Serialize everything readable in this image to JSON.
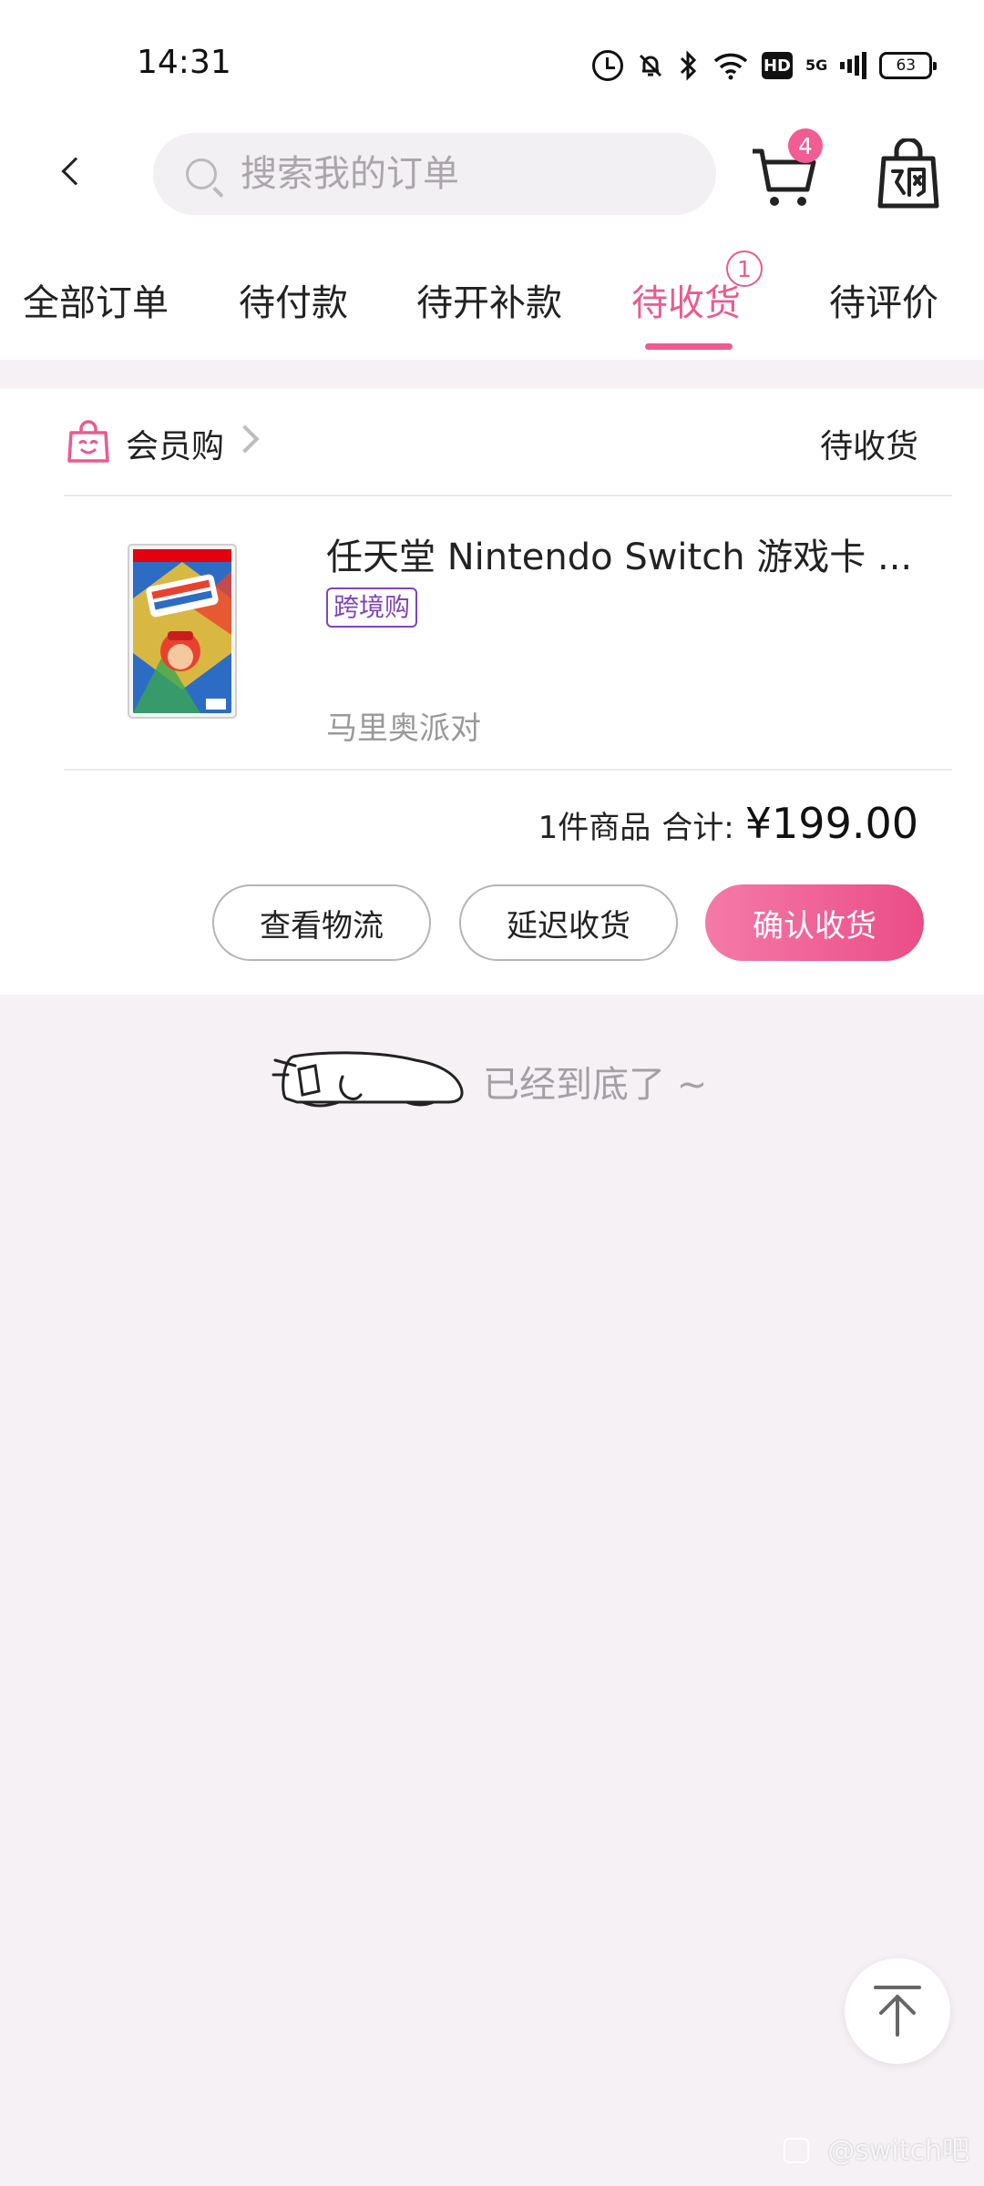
{
  "status_bar": {
    "time": "14:31",
    "icons": [
      "alarm-icon",
      "bell-off-icon",
      "bluetooth-icon",
      "wifi-icon",
      "hd-icon",
      "5g-signal-icon",
      "battery-icon"
    ],
    "hd_label": "HD",
    "network_label": "5G",
    "battery": "63"
  },
  "header": {
    "search_placeholder": "搜索我的订单",
    "cart_badge": "4",
    "colors": {
      "accent": "#eb5a90"
    }
  },
  "tabs": [
    {
      "label": "全部订单",
      "active": false
    },
    {
      "label": "待付款",
      "active": false
    },
    {
      "label": "待开补款",
      "active": false
    },
    {
      "label": "待收货",
      "active": true,
      "badge": "1"
    },
    {
      "label": "待评价",
      "active": false
    }
  ],
  "order": {
    "store_name": "会员购",
    "status": "待收货",
    "product": {
      "title": "任天堂 Nintendo Switch 游戏卡 ...",
      "tag": "跨境购",
      "spec": "马里奥派对",
      "image": "super-mario-party-game-box"
    },
    "item_count": "1件商品",
    "total_label": "合计:",
    "total_amount": "¥199.00",
    "buttons": {
      "logistics": "查看物流",
      "delay": "延迟收货",
      "confirm": "确认收货"
    }
  },
  "end_of_list": "已经到底了 ~",
  "watermark": "@switch吧"
}
